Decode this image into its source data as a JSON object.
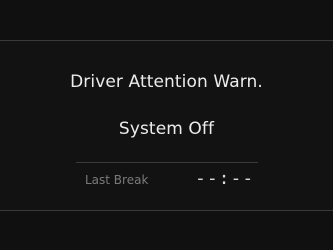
{
  "message": {
    "line1": "Driver Attention Warn.",
    "line2": "System Off"
  },
  "last_break": {
    "label": "Last Break",
    "value": "--:--"
  }
}
